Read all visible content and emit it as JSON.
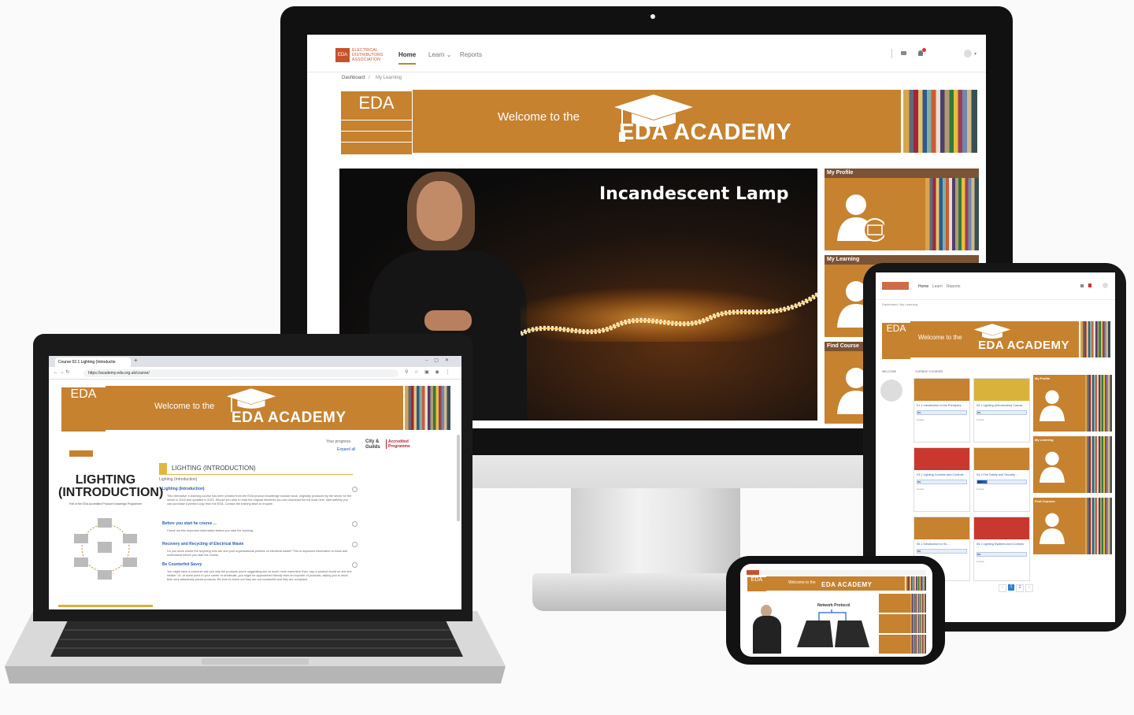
{
  "monitor": {
    "nav": {
      "logo_line1": "ELECTRICAL",
      "logo_line2": "DISTRIBUTORS",
      "logo_line3": "ASSOCIATION",
      "logo_mark": "EDA",
      "items": [
        {
          "label": "Home",
          "active": true
        },
        {
          "label": "Learn ⌄",
          "active": false
        },
        {
          "label": "Reports",
          "active": false
        }
      ]
    },
    "breadcrumb": [
      "Dashboard",
      "/",
      "My Learning"
    ],
    "banner": {
      "eda": "EDA",
      "welcome": "Welcome to the",
      "academy": "EDA ACADEMY"
    },
    "video": {
      "title": "Incandescent Lamp"
    },
    "tiles": [
      {
        "label": "My Profile",
        "icon": "profile-card-icon"
      },
      {
        "label": "My Learning",
        "icon": "learning-icon"
      },
      {
        "label": "Find Course",
        "icon": "find-course-icon"
      }
    ]
  },
  "laptop": {
    "tab_title": "Course 02.1 Lighting (Introductio",
    "url": "https://academy.eda.org.uk/course/",
    "banner": {
      "eda": "EDA",
      "welcome": "Welcome to the",
      "academy": "EDA ACADEMY"
    },
    "progress_label": "Your progress",
    "expand_all": "Expand all",
    "city_guilds": "City & Guilds",
    "accredited": "Accredited Programme",
    "book_title_1": "LIGHTING",
    "book_title_2": "(INTRODUCTION)",
    "book_sub": "Part of the EDA Accredited Product Knowledge Programme",
    "section_title": "LIGHTING (INTRODUCTION)",
    "section_sub": "Lighting (Introduction)",
    "items": [
      {
        "title": "Lighting (Introduction)",
        "text": "This interactive e-learning course has been created from the EDA product knowledge module book, originally produced by the sector for the sector in 2015 and updated in 2023. Should you wish to read the original elements you can download the full book here. Alternatively you can purchase a printed copy from the EDA. Contact the training team to enquire."
      },
      {
        "title": "Before you start he course ...",
        "text": "Check out this important information before you start the learning"
      },
      {
        "title": "Recovery and Recycling of Electrical Waste",
        "text": "Do you know where the recycling bins are and your organisational policies on electrical waste? This is important information to know and understand before you start the course."
      },
      {
        "title": "Be Counterfeit Savvy",
        "text": "You might have a customer ask you why the products you're suggesting are so much more expensive than, say, a product found on one line retailer. Or, at some point in your career in wholesale, you might be approached directly from an importer of products, asking you to stock their very attractively priced products. Be sure to check out they are not counterfeit and they are compliant."
      }
    ]
  },
  "tablet": {
    "nav_items": [
      "Home",
      "Learn",
      "Reports"
    ],
    "breadcrumb": "Dashboard / My Learning",
    "banner": {
      "eda": "EDA",
      "welcome": "Welcome to the",
      "academy": "EDA ACADEMY"
    },
    "col_welcome": "WELCOME",
    "col_courses": "CURRENT COURSES",
    "courses": [
      {
        "title": "01.1 Introduction to the Principles ...",
        "progress": "0%",
        "tag": "Course",
        "color": "#c6822f"
      },
      {
        "title": "02.1 Lighting (Introduction) Course",
        "progress": "0%",
        "tag": "Course",
        "color": "#d8b23a"
      },
      {
        "title": "03.1 Lighting Controls and Controls ...",
        "progress": "0%",
        "tag": "Course",
        "color": "#c9382f"
      },
      {
        "title": "04.1 Fire Safety and Security ...",
        "progress": "20%",
        "tag": "Course",
        "color": "#c6822f"
      },
      {
        "title": "05.1 Introduction to Ho ...",
        "progress": "0%",
        "tag": "Course",
        "color": "#c6822f"
      },
      {
        "title": "06.1 Lighting Systems and Controls ...",
        "progress": "0%",
        "tag": "Course",
        "color": "#c9382f"
      }
    ],
    "tiles": [
      "My Profile",
      "My Learning",
      "Find Courses"
    ],
    "pagination": [
      "‹",
      "1",
      "2",
      "›"
    ]
  },
  "phone": {
    "banner": {
      "eda": "EDA",
      "welcome": "Welcome to the",
      "academy": "EDA ACADEMY"
    },
    "video_title": "Network Protocol"
  }
}
